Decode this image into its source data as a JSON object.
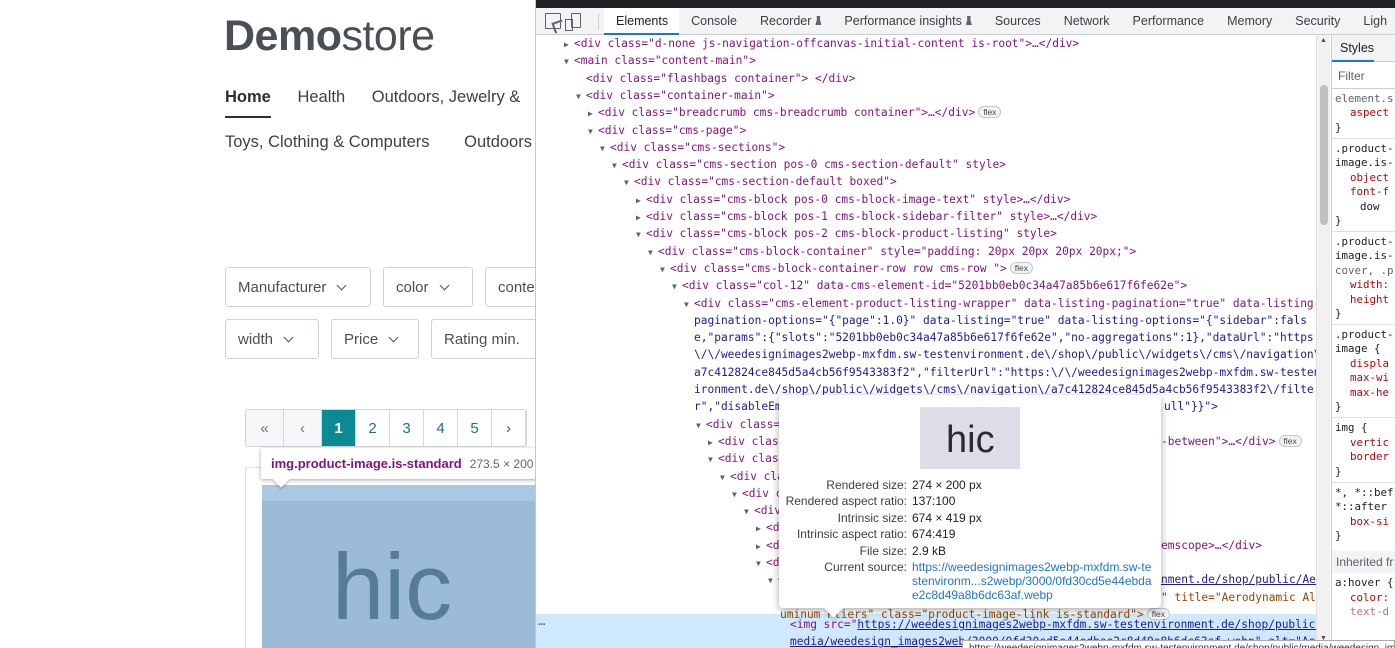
{
  "store": {
    "logo_bold": "Demo",
    "logo_light": "store",
    "nav_row1": [
      "Home",
      "Health",
      "Outdoors, Jewelry &"
    ],
    "nav_row2": [
      "Toys, Clothing & Computers",
      "Outdoors"
    ],
    "filters_row1": [
      "Manufacturer",
      "color",
      "conte"
    ],
    "filters_row2": [
      "width",
      "Price",
      "Rating min."
    ],
    "pagination": [
      "«",
      "‹",
      "1",
      "2",
      "3",
      "4",
      "5",
      "›"
    ],
    "current_page": "1",
    "product_text": "hic",
    "accent_color": "#0b8a94"
  },
  "element_tooltip": {
    "selector": "img.product-image.is-standard",
    "dimensions": "273.5 × 200"
  },
  "devtools": {
    "tabs": [
      "Elements",
      "Console",
      "Recorder",
      "Performance insights",
      "Sources",
      "Network",
      "Performance",
      "Memory",
      "Security",
      "Ligh"
    ],
    "active_tab": "Elements",
    "styles_tab": "Styles",
    "styles_filter_placeholder": "Filter",
    "inherited_label": "Inherited fr",
    "dom_lines": {
      "l1": "<div class=\"d-none js-navigation-offcanvas-initial-content is-root\">…</div>",
      "l2": "<main class=\"content-main\">",
      "l3": "<div class=\"flashbags container\"> </div>",
      "l4": "<div class=\"container-main\">",
      "l5": "<div class=\"breadcrumb cms-breadcrumb container\">…</div>",
      "l6": "<div class=\"cms-page\">",
      "l7": "<div class=\"cms-sections\">",
      "l8": "<div class=\"cms-section  pos-0 cms-section-default\" style>",
      "l9": "<div class=\"cms-section-default boxed\">",
      "l10": "<div class=\"cms-block  pos-0 cms-block-image-text\" style>…</div>",
      "l11": "<div class=\"cms-block  pos-1 cms-block-sidebar-filter\" style>…</div>",
      "l12": "<div class=\"cms-block  pos-2 cms-block-product-listing\" style>",
      "l13": "<div class=\"cms-block-container\" style=\"padding: 20px 20px 20px 20px;\">",
      "l14": "<div class=\"cms-block-container-row row cms-row \">",
      "l15": "<div class=\"col-12\" data-cms-element-id=\"5201bb0eb0c34a47a85b6e617f6fe62e\">",
      "l16a": "<div class=\"cms-element-product-listing-wrapper\" data-listing-pagination=\"true\" data-listing-",
      "l16b": "pagination-options=\"{\"page\":1.0}\" data-listing=\"true\" data-listing-options=\"{\"sidebar\":fals",
      "l16c": "e,\"params\":{\"slots\":\"5201bb0eb0c34a47a85b6e617f6fe62e\",\"no-aggregations\":1},\"dataUrl\":\"https:",
      "l16d": "\\/\\/weedesignimages2webp-mxfdm.sw-testenvironment.de\\/shop\\/public\\/widgets\\/cms\\/navigation\\/",
      "l16e": "a7c412824ce845d5a4cb56f9543383f2\",\"filterUrl\":\"https:\\/\\/weedesignimages2webp-mxfdm.sw-testenv",
      "l16f": "ironment.de\\/shop\\/public\\/widgets\\/cms\\/navigation\\/a7c412824ce845d5a4cb56f9543383f2\\/filte",
      "l16g": "r\",\"disableEm",
      "l16g_tail": "ull\"}}\">",
      "l17": "<div class=",
      "l18": "<div class",
      "l18_tail": "-between\">…</div>",
      "l19": "<div class",
      "l20": "<div cla",
      "l21": "<div c",
      "l22": "<div",
      "l23": "<d",
      "l24": "<d",
      "l24_tail": "emscope>…</div>",
      "l25": "<d",
      "l26": "<",
      "l26_link": "nment.de/shop/public/Aer",
      "l27_tail": "\" title=\"Aerodynamic Al",
      "l28": "uminum Pliers\" class=\"product-image-link is-standard\">",
      "l29_pre": "<img src=\"",
      "l29_link": "https://weedesignimages2webp-mxfdm.sw-testenvironment.de/shop/public/",
      "l30_link": "media/weedesign_images2web",
      "l30_tail": "/3000/0fd30cd5e44edbae2c8d49a8b6dc63af.webp\" alt=\"Aer"
    },
    "badge_flex": "flex"
  },
  "img_popup": {
    "thumb_text": "hic",
    "rows": [
      {
        "k": "Rendered size:",
        "v": "274 × 200 px"
      },
      {
        "k": "Rendered aspect ratio:",
        "v": "137:100"
      },
      {
        "k": "Intrinsic size:",
        "v": "674 × 419 px"
      },
      {
        "k": "Intrinsic aspect ratio:",
        "v": "674:419"
      },
      {
        "k": "File size:",
        "v": "2.9 kB"
      },
      {
        "k": "Current source:",
        "v": ""
      }
    ],
    "current_source": "https://weedesignimages2webp-mxfdm.sw-testenvironm...s2webp/3000/0fd30cd5e44ebdae2c8d49a8b6dc63af.webp"
  },
  "url_tooltip": "https://weedesignimages2webp-mxfdm.sw-testenvironment.de/shop/public/media/weedesign_images2webp",
  "styles_panel": {
    "lines": [
      "element.s",
      "aspect",
      "}",
      ".product-",
      "image.is-",
      "object",
      "font-f",
      "dow",
      "}",
      ".product-",
      "image.is-",
      "cover, .p",
      "width:",
      "height",
      "}",
      ".product-",
      "image {",
      "displa",
      "max-wi",
      "max-he",
      "}",
      "img {",
      "vertic",
      "border",
      "}",
      "*, *::bef",
      "*::after",
      "box-si",
      "}",
      "a:hover {",
      "color:",
      "text-d"
    ]
  }
}
